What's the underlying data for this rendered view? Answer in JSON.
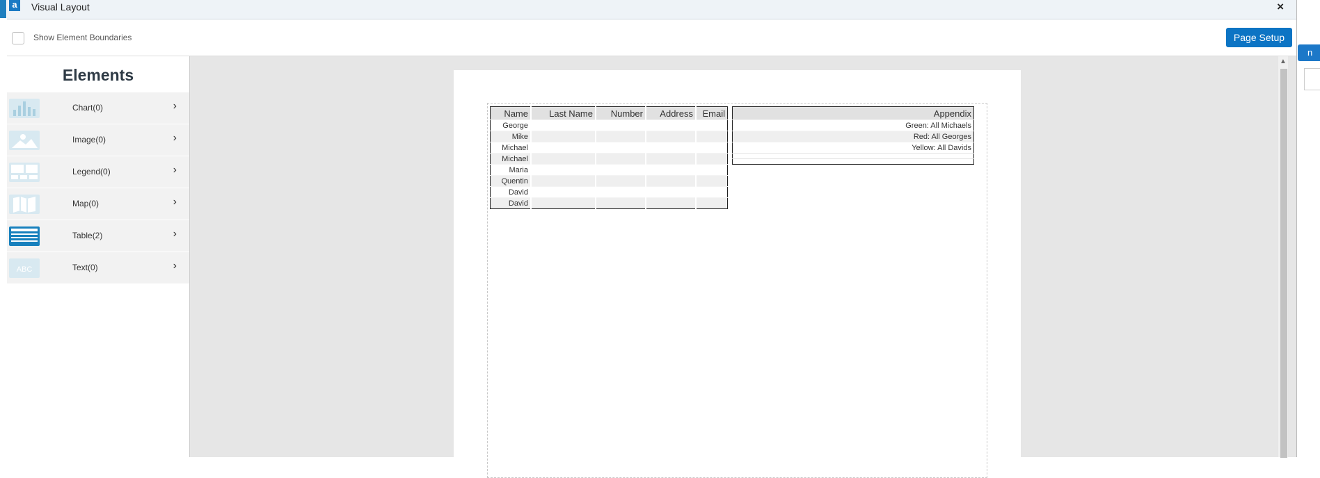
{
  "dialog": {
    "title": "Visual Layout",
    "logo_letter": "a",
    "close": "×"
  },
  "toolbar": {
    "show_boundaries_label": "Show Element Boundaries",
    "page_setup_label": "Page Setup"
  },
  "background": {
    "right_button_label": "n"
  },
  "sidebar": {
    "title": "Elements",
    "items": [
      {
        "label": "Chart(0)",
        "icon": "chart-icon",
        "active": false
      },
      {
        "label": "Image(0)",
        "icon": "image-icon",
        "active": false
      },
      {
        "label": "Legend(0)",
        "icon": "legend-icon",
        "active": false
      },
      {
        "label": "Map(0)",
        "icon": "map-icon",
        "active": false
      },
      {
        "label": "Table(2)",
        "icon": "table-icon",
        "active": true
      },
      {
        "label": "Text(0)",
        "icon": "text-icon",
        "active": false
      }
    ],
    "text_icon_label": "ABC"
  },
  "main_table": {
    "headers": [
      "Name",
      "Last Name",
      "Number",
      "Address",
      "Email"
    ],
    "rows": [
      [
        "George",
        "",
        "",
        "",
        ""
      ],
      [
        "Mike",
        "",
        "",
        "",
        ""
      ],
      [
        "Michael",
        "",
        "",
        "",
        ""
      ],
      [
        "Michael",
        "",
        "",
        "",
        ""
      ],
      [
        "Maria",
        "",
        "",
        "",
        ""
      ],
      [
        "Quentin",
        "",
        "",
        "",
        ""
      ],
      [
        "David",
        "",
        "",
        "",
        ""
      ],
      [
        "David",
        "",
        "",
        "",
        ""
      ]
    ]
  },
  "appendix_table": {
    "header": "Appendix",
    "rows": [
      "Green: All Michaels",
      "Red: All Georges",
      "Yellow: All Davids",
      "",
      ""
    ]
  }
}
